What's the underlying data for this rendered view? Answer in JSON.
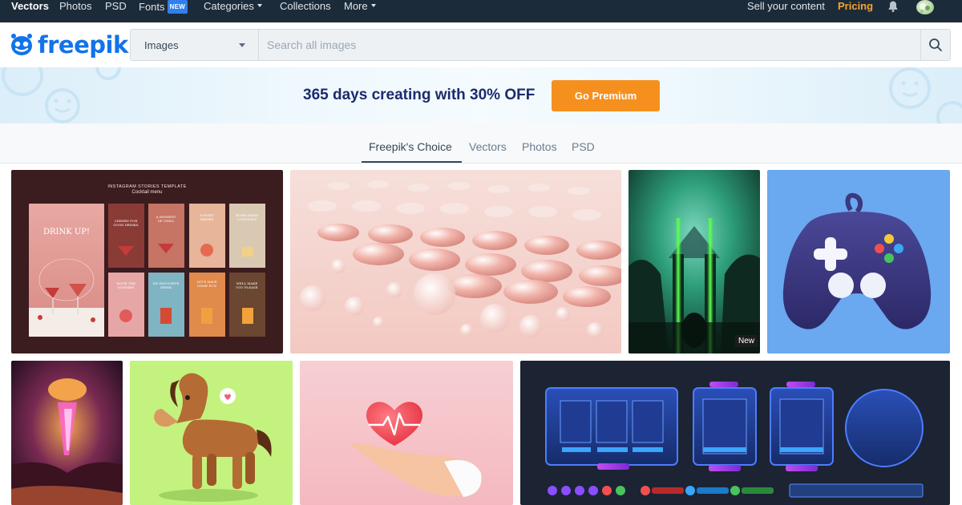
{
  "topnav": {
    "items": [
      "Vectors",
      "Photos",
      "PSD",
      "Fonts",
      "Categories",
      "Collections",
      "More"
    ],
    "fonts_badge": "NEW",
    "sell": "Sell your content",
    "pricing": "Pricing",
    "bell_icon": "bell-icon",
    "avatar_icon": "user-avatar"
  },
  "header": {
    "logo": "freepik",
    "search_type": "Images",
    "search_placeholder": "Search all images",
    "search_icon": "search-icon"
  },
  "promo": {
    "text": "365 days creating with 30% OFF",
    "cta": "Go Premium"
  },
  "tabs": {
    "items": [
      "Freepik's Choice",
      "Vectors",
      "Photos",
      "PSD"
    ],
    "active": "Freepik's Choice"
  },
  "tiles": {
    "cocktail": {
      "header": "INSTAGRAM STORIES TEMPLATE",
      "subheader": "Cocktail menu",
      "cards": [
        "DRINK UP!",
        "CHEERS FOR GOOD DRINKS",
        "A MOMENT OF CHILL",
        "SUNSET DRINKS",
        "HOME MADE COCKTAILS",
        "TASTE THE SUMMER",
        "MY FAVOURITE DRINK",
        "LET'S HAVE SOME FUN",
        "WELL MAKE YOU PLEASE"
      ]
    },
    "forest_badge": "New"
  },
  "colors": {
    "topnav_bg": "#1c2b39",
    "brand_blue": "#1273eb",
    "pricing_orange": "#f7a42c",
    "cta_orange": "#f5901e"
  }
}
